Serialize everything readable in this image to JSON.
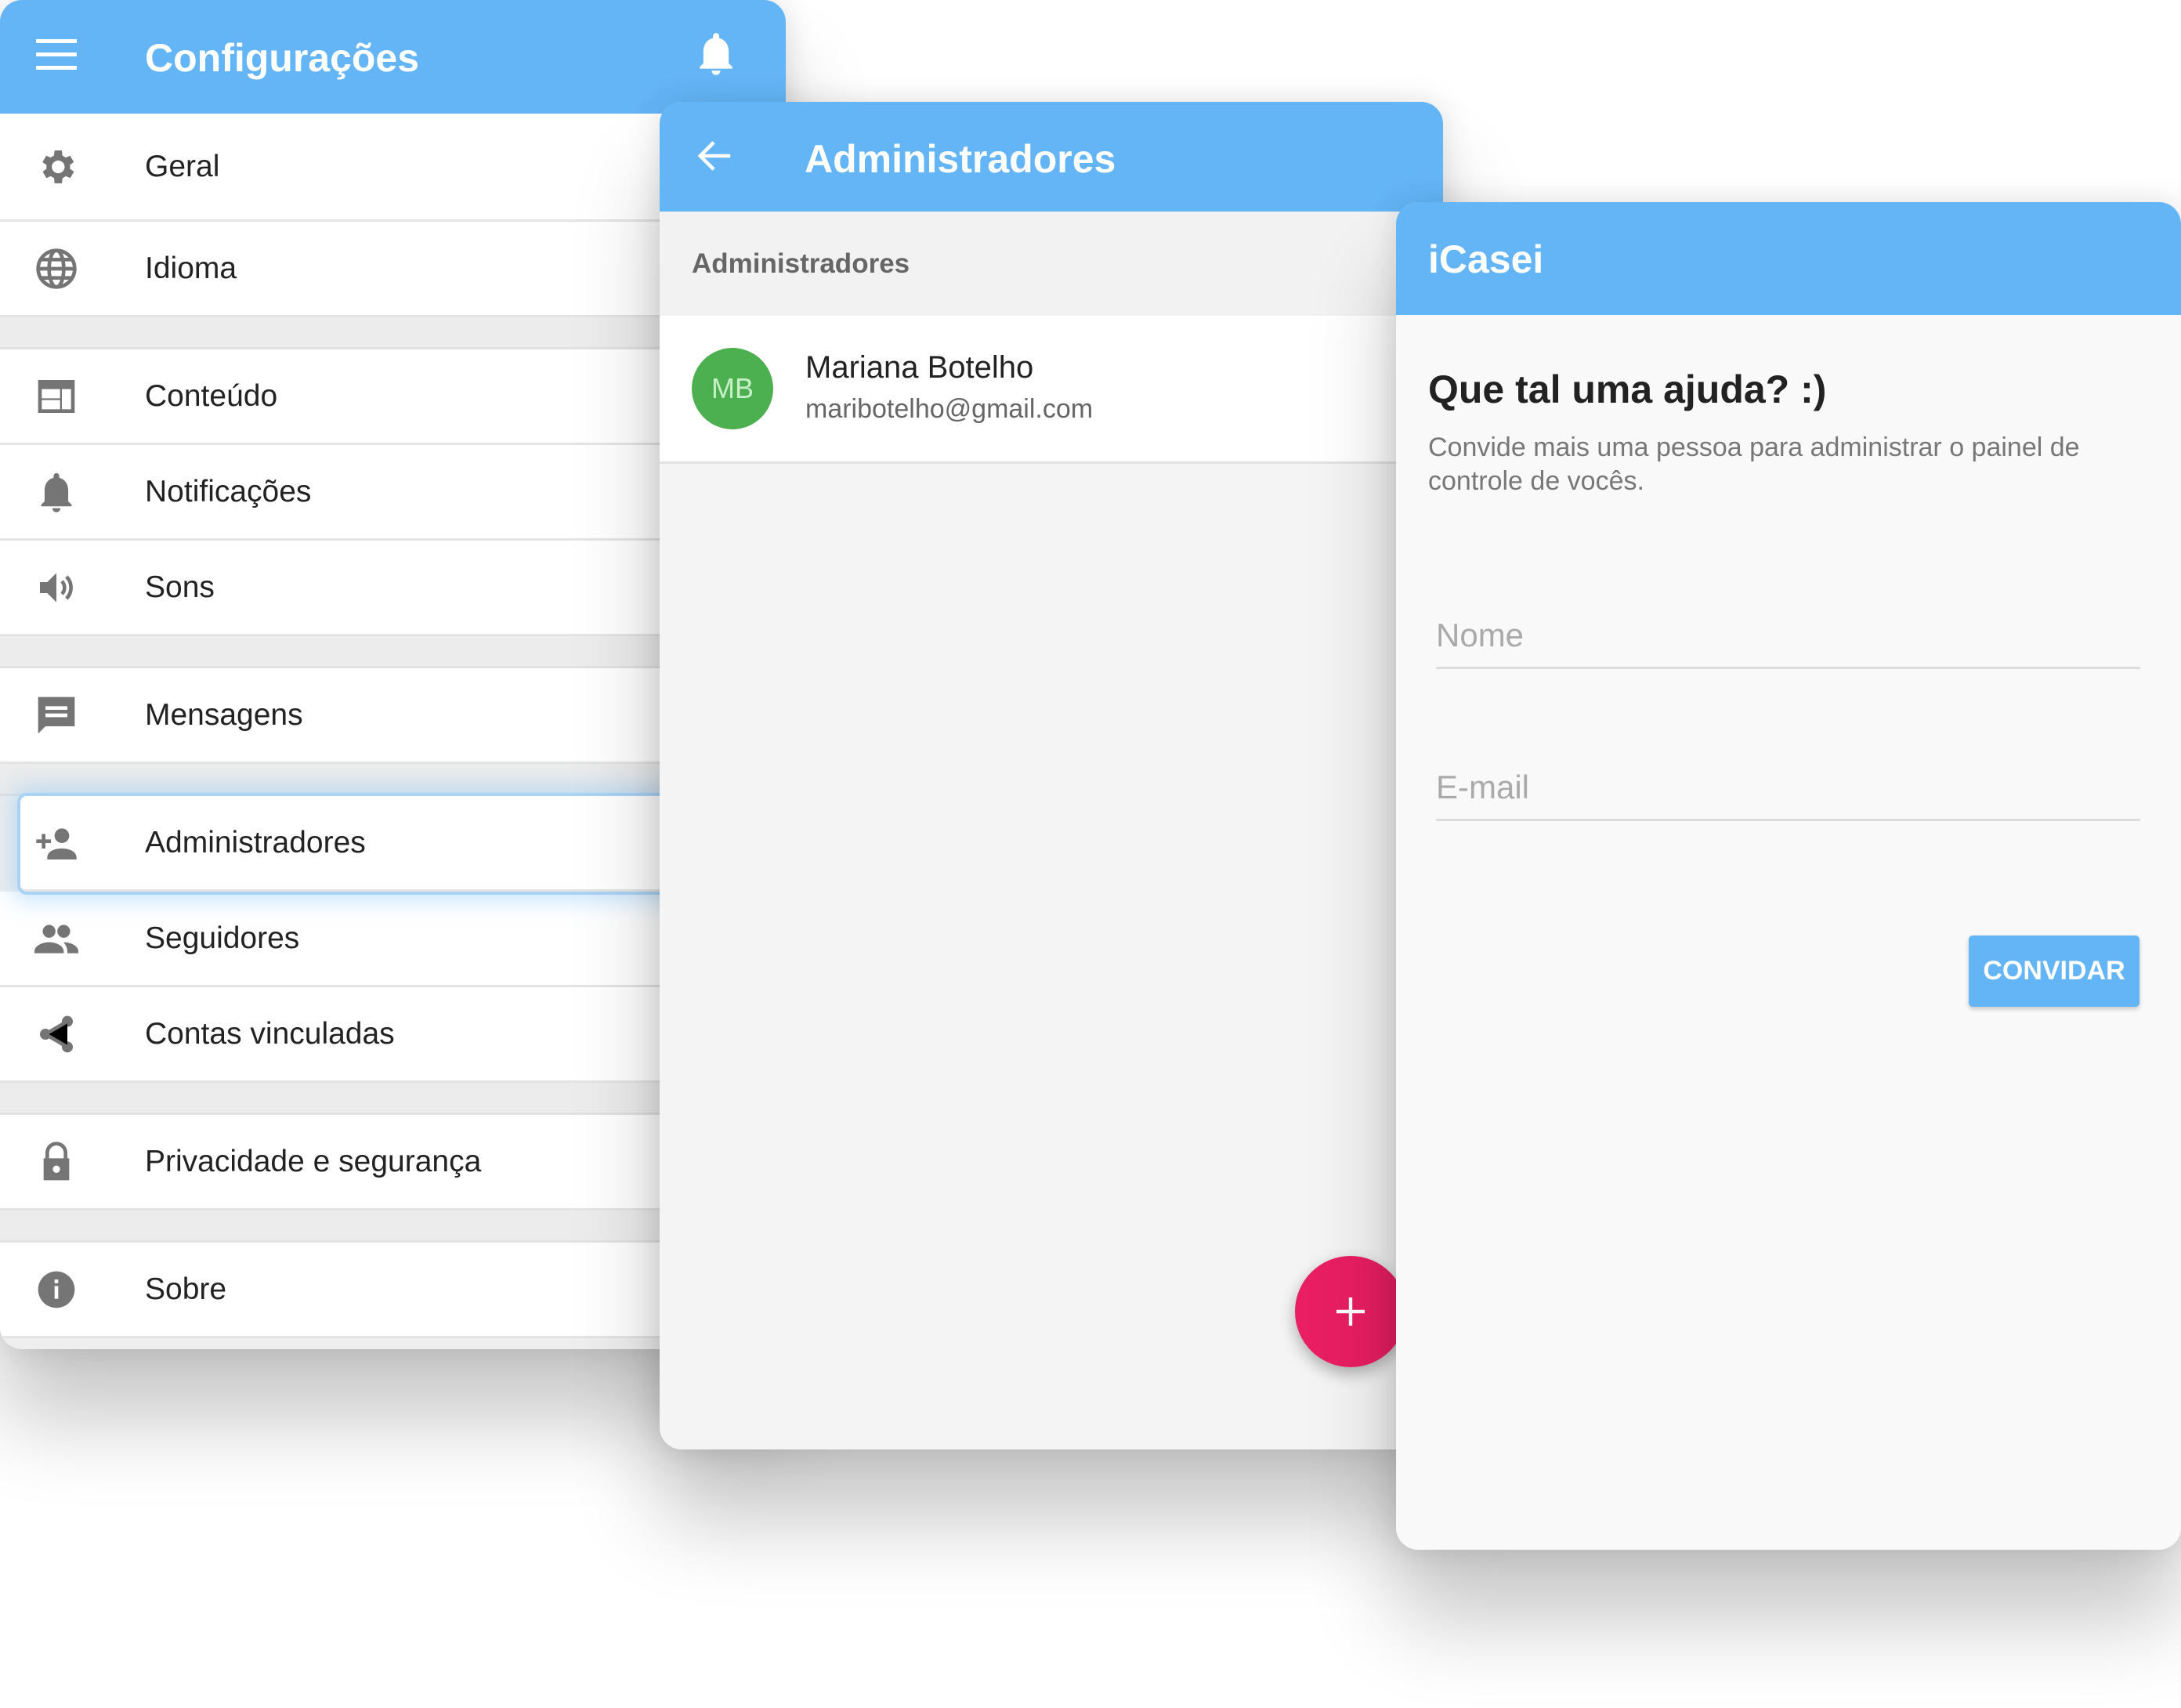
{
  "settings": {
    "title": "Configurações",
    "items": [
      {
        "label": "Geral",
        "icon": "gear-icon"
      },
      {
        "label": "Idioma",
        "icon": "globe-icon"
      },
      {
        "label": "Conteúdo",
        "icon": "layout-icon"
      },
      {
        "label": "Notificações",
        "icon": "bell-icon"
      },
      {
        "label": "Sons",
        "icon": "speaker-icon"
      },
      {
        "label": "Mensagens",
        "icon": "message-icon"
      },
      {
        "label": "Administradores",
        "icon": "person-add-icon"
      },
      {
        "label": "Seguidores",
        "icon": "people-icon"
      },
      {
        "label": "Contas vinculadas",
        "icon": "share-icon"
      },
      {
        "label": "Privacidade e segurança",
        "icon": "lock-icon"
      },
      {
        "label": "Sobre",
        "icon": "info-icon"
      }
    ],
    "selected": "Administradores"
  },
  "admins": {
    "title": "Administradores",
    "section_label": "Administradores",
    "list": [
      {
        "initials": "MB",
        "name": "Mariana Botelho",
        "email": "maribotelho@gmail.com"
      }
    ]
  },
  "invite": {
    "title": "iCasei",
    "heading": "Que tal uma ajuda? :)",
    "description": "Convide mais uma pessoa para administrar o painel de controle de vocês.",
    "name_placeholder": "Nome",
    "email_placeholder": "E-mail",
    "button_label": "CONVIDAR"
  },
  "colors": {
    "primary": "#64b5f6",
    "fab": "#e91e63",
    "avatar": "#4caf50"
  }
}
